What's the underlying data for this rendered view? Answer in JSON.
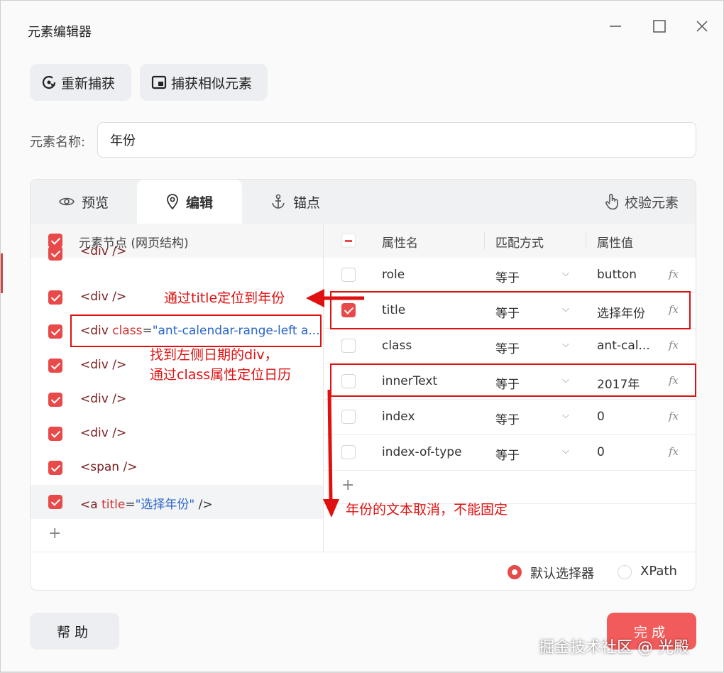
{
  "window": {
    "title": "元素编辑器",
    "controls": {
      "minimize": "—",
      "maximize": "☐",
      "close": "✕"
    }
  },
  "toolbar": {
    "recapture_label": "重新捕获",
    "capture_similar_label": "捕获相似元素"
  },
  "element_name": {
    "label": "元素名称:",
    "value": "年份"
  },
  "tabs": [
    {
      "label": "预览",
      "icon": "eye-icon",
      "active": false
    },
    {
      "label": "编辑",
      "icon": "location-pin-icon",
      "active": true
    },
    {
      "label": "锚点",
      "icon": "anchor-icon",
      "active": false
    }
  ],
  "verify_label": "校验元素",
  "nodes": {
    "header": "元素节点 (网页结构)",
    "items": [
      {
        "tag": "<div />",
        "checked": true
      },
      {
        "tag": "<div />",
        "checked": true
      },
      {
        "open": "<div ",
        "attr": "class",
        "eq": "=",
        "val": "\"ant-calendar-range-left a...",
        "checked": true
      },
      {
        "tag": "<div />",
        "checked": true
      },
      {
        "tag": "<div />",
        "checked": true
      },
      {
        "tag": "<div />",
        "checked": true
      },
      {
        "tag": "<span />",
        "checked": true
      },
      {
        "open": "<a ",
        "attr": "title",
        "eq": "=",
        "val": "\"选择年份\"",
        "close": " />",
        "checked": true,
        "selected": true
      }
    ],
    "add_symbol": "+"
  },
  "properties": {
    "headers": {
      "name": "属性名",
      "match": "匹配方式",
      "value": "属性值"
    },
    "rows": [
      {
        "name": "role",
        "match": "等于",
        "value": "button",
        "checked": false
      },
      {
        "name": "title",
        "match": "等于",
        "value": "选择年份",
        "checked": true
      },
      {
        "name": "class",
        "match": "等于",
        "value": "ant-cal...",
        "checked": false
      },
      {
        "name": "innerText",
        "match": "等于",
        "value": "2017年",
        "checked": false
      },
      {
        "name": "index",
        "match": "等于",
        "value": "0",
        "checked": false
      },
      {
        "name": "index-of-type",
        "match": "等于",
        "value": "0",
        "checked": false
      }
    ],
    "fx_label": "fx",
    "chevron": "⌵",
    "add_symbol": "+"
  },
  "selector_mode": {
    "default_label": "默认选择器",
    "xpath_label": "XPath",
    "selected": "default"
  },
  "footer": {
    "help_label": "帮助",
    "done_label": "完成"
  },
  "annotations": {
    "title_note": "通过title定位到年份",
    "class_note_line1": "找到左侧日期的div，",
    "class_note_line2": "通过class属性定位日历",
    "text_note": "年份的文本取消，不能固定"
  },
  "watermark": "掘金技术社区 @ 光殿",
  "colors": {
    "accent": "#e84a4a",
    "annotation": "#e01010",
    "done_button": "#f25b5b"
  }
}
